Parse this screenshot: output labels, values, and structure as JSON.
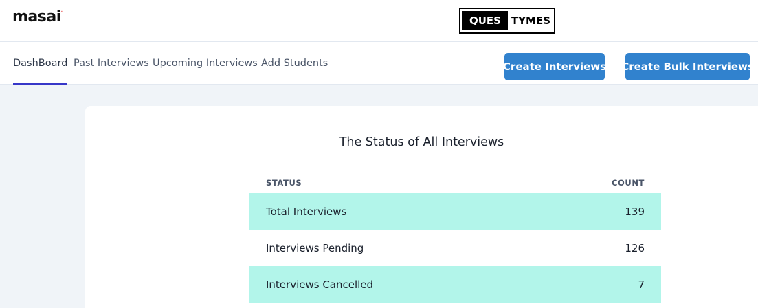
{
  "header": {
    "logo_text": "masai",
    "logo_mark": ".",
    "brand_left": "QUES",
    "brand_right": "TYMES"
  },
  "nav": {
    "tabs": [
      {
        "label": "DashBoard",
        "active": true
      },
      {
        "label": "Past Interviews",
        "active": false
      },
      {
        "label": "Upcoming Interviews",
        "active": false
      },
      {
        "label": "Add Students",
        "active": false
      }
    ],
    "create_button": "Create Interviews",
    "bulk_button": "Create Bulk Interviews"
  },
  "main": {
    "title": "The Status of All Interviews",
    "table": {
      "headers": [
        "STATUS",
        "COUNT"
      ],
      "rows": [
        {
          "status": "Total Interviews",
          "count": "139"
        },
        {
          "status": "Interviews Pending",
          "count": "126"
        },
        {
          "status": "Interviews Cancelled",
          "count": "7"
        }
      ]
    }
  },
  "colors": {
    "primary": "#3182ce",
    "stripe": "#b2f5ea",
    "background": "#f0f4f8",
    "active_tab_underline": "#3737c8"
  }
}
